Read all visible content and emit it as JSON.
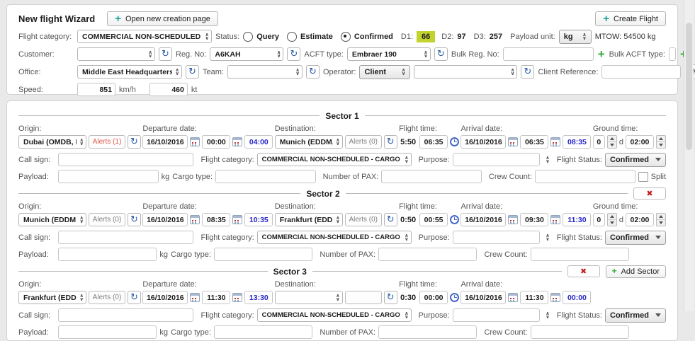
{
  "colors": {
    "accent_teal": "#17a398",
    "green_plus": "#2fae3a",
    "alert_red": "#e25647",
    "d1_highlight": "#c3d32e",
    "secondary_time_blue": "#2626c9",
    "refresh_blue": "#2b5ca8",
    "delete_red": "#c21c1c"
  },
  "header": {
    "title": "New flight Wizard",
    "open_new_btn": "Open new creation page",
    "create_flight_btn": "Create Flight",
    "row2": {
      "flight_category_label": "Flight category:",
      "flight_category_value": "COMMERCIAL NON-SCHEDULED",
      "status_label": "Status:",
      "status_query": "Query",
      "status_estimate": "Estimate",
      "status_confirmed": "Confirmed",
      "status_selected": "Confirmed",
      "d1_label": "D1:",
      "d1_value": "66",
      "d2_label": "D2:",
      "d2_value": "97",
      "d3_label": "D3:",
      "d3_value": "257",
      "payload_unit_label": "Payload unit:",
      "payload_unit_value": "kg",
      "mtow": "MTOW: 54500 kg"
    },
    "row3": {
      "customer_label": "Customer:",
      "customer_value": "",
      "reg_no_label": "Reg. No:",
      "reg_no_value": "A6KAH",
      "acft_type_label": "ACFT type:",
      "acft_type_value": "Embraer 190",
      "bulk_reg_label": "Bulk Reg. No:",
      "bulk_reg_value": "",
      "bulk_acft_label": "Bulk ACFT type:",
      "bulk_acft_value": ""
    },
    "row4": {
      "office_label": "Office:",
      "office_value": "Middle East Headquarters",
      "team_label": "Team:",
      "team_value": "",
      "operator_label": "Operator:",
      "operator_value": "Client",
      "operator_second_value": "",
      "client_ref_label": "Client Reference:",
      "client_ref_value": "",
      "map_btn": "Map"
    },
    "row5": {
      "speed_label": "Speed:",
      "kmh_value": "851",
      "kmh_unit": "km/h",
      "kt_value": "460",
      "kt_unit": "kt"
    }
  },
  "sector_labels": {
    "origin": "Origin:",
    "departure_date": "Departure date:",
    "destination": "Destination:",
    "flight_time": "Flight time:",
    "arrival_date": "Arrival date:",
    "ground_time": "Ground time:",
    "ground_days_unit": "d",
    "call_sign": "Call sign:",
    "flight_category": "Flight category:",
    "purpose": "Purpose:",
    "flight_status": "Flight Status:",
    "payload": "Payload:",
    "payload_unit": "kg",
    "cargo_type": "Cargo type:",
    "number_of_pax": "Number of PAX:",
    "crew_count": "Crew Count:",
    "split": "Split",
    "add_sector_btn": "Add Sector"
  },
  "sectors": [
    {
      "title": "Sector 1",
      "origin": "Dubai (OMDB, DXB) Dub",
      "origin_alerts": "Alerts (1)",
      "dep_date": "16/10/2016",
      "dep_time": "00:00",
      "dep_local": "04:00",
      "destination": "Munich (EDDM, MUC) Fi",
      "dest_alerts": "Alerts (0)",
      "flight_time_est": "5:50",
      "flight_time": "06:35",
      "arr_date": "16/10/2016",
      "arr_time": "06:35",
      "arr_local": "08:35",
      "ground_days": "0",
      "ground_time": "02:00",
      "call_sign": "",
      "category": "COMMERCIAL NON-SCHEDULED - CARGO AIRLINE",
      "purpose": "",
      "flight_status": "Confirmed",
      "payload": "",
      "cargo_type": "",
      "pax": "",
      "crew": ""
    },
    {
      "title": "Sector 2",
      "origin": "Munich (EDDM, MUC) Fi",
      "origin_alerts": "Alerts (0)",
      "dep_date": "16/10/2016",
      "dep_time": "08:35",
      "dep_local": "10:35",
      "destination": "Frankfurt (EDDF, FRA) F",
      "dest_alerts": "Alerts (0)",
      "flight_time_est": "0:50",
      "flight_time": "00:55",
      "arr_date": "16/10/2016",
      "arr_time": "09:30",
      "arr_local": "11:30",
      "ground_days": "0",
      "ground_time": "02:00",
      "call_sign": "",
      "category": "COMMERCIAL NON-SCHEDULED - CARGO AIRLINE",
      "purpose": "",
      "flight_status": "Confirmed",
      "payload": "",
      "cargo_type": "",
      "pax": "",
      "crew": ""
    },
    {
      "title": "Sector 3",
      "origin": "Frankfurt (EDDF, FRA) F",
      "origin_alerts": "Alerts (0)",
      "dep_date": "16/10/2016",
      "dep_time": "11:30",
      "dep_local": "13:30",
      "destination": "",
      "dest_alerts": "",
      "flight_time_est": "0:30",
      "flight_time": "00:00",
      "arr_date": "16/10/2016",
      "arr_time": "11:30",
      "arr_local": "00:00",
      "call_sign": "",
      "category": "COMMERCIAL NON-SCHEDULED - CARGO AIRLINE",
      "purpose": "",
      "flight_status": "Confirmed",
      "payload": "",
      "cargo_type": "",
      "pax": "",
      "crew": ""
    }
  ]
}
